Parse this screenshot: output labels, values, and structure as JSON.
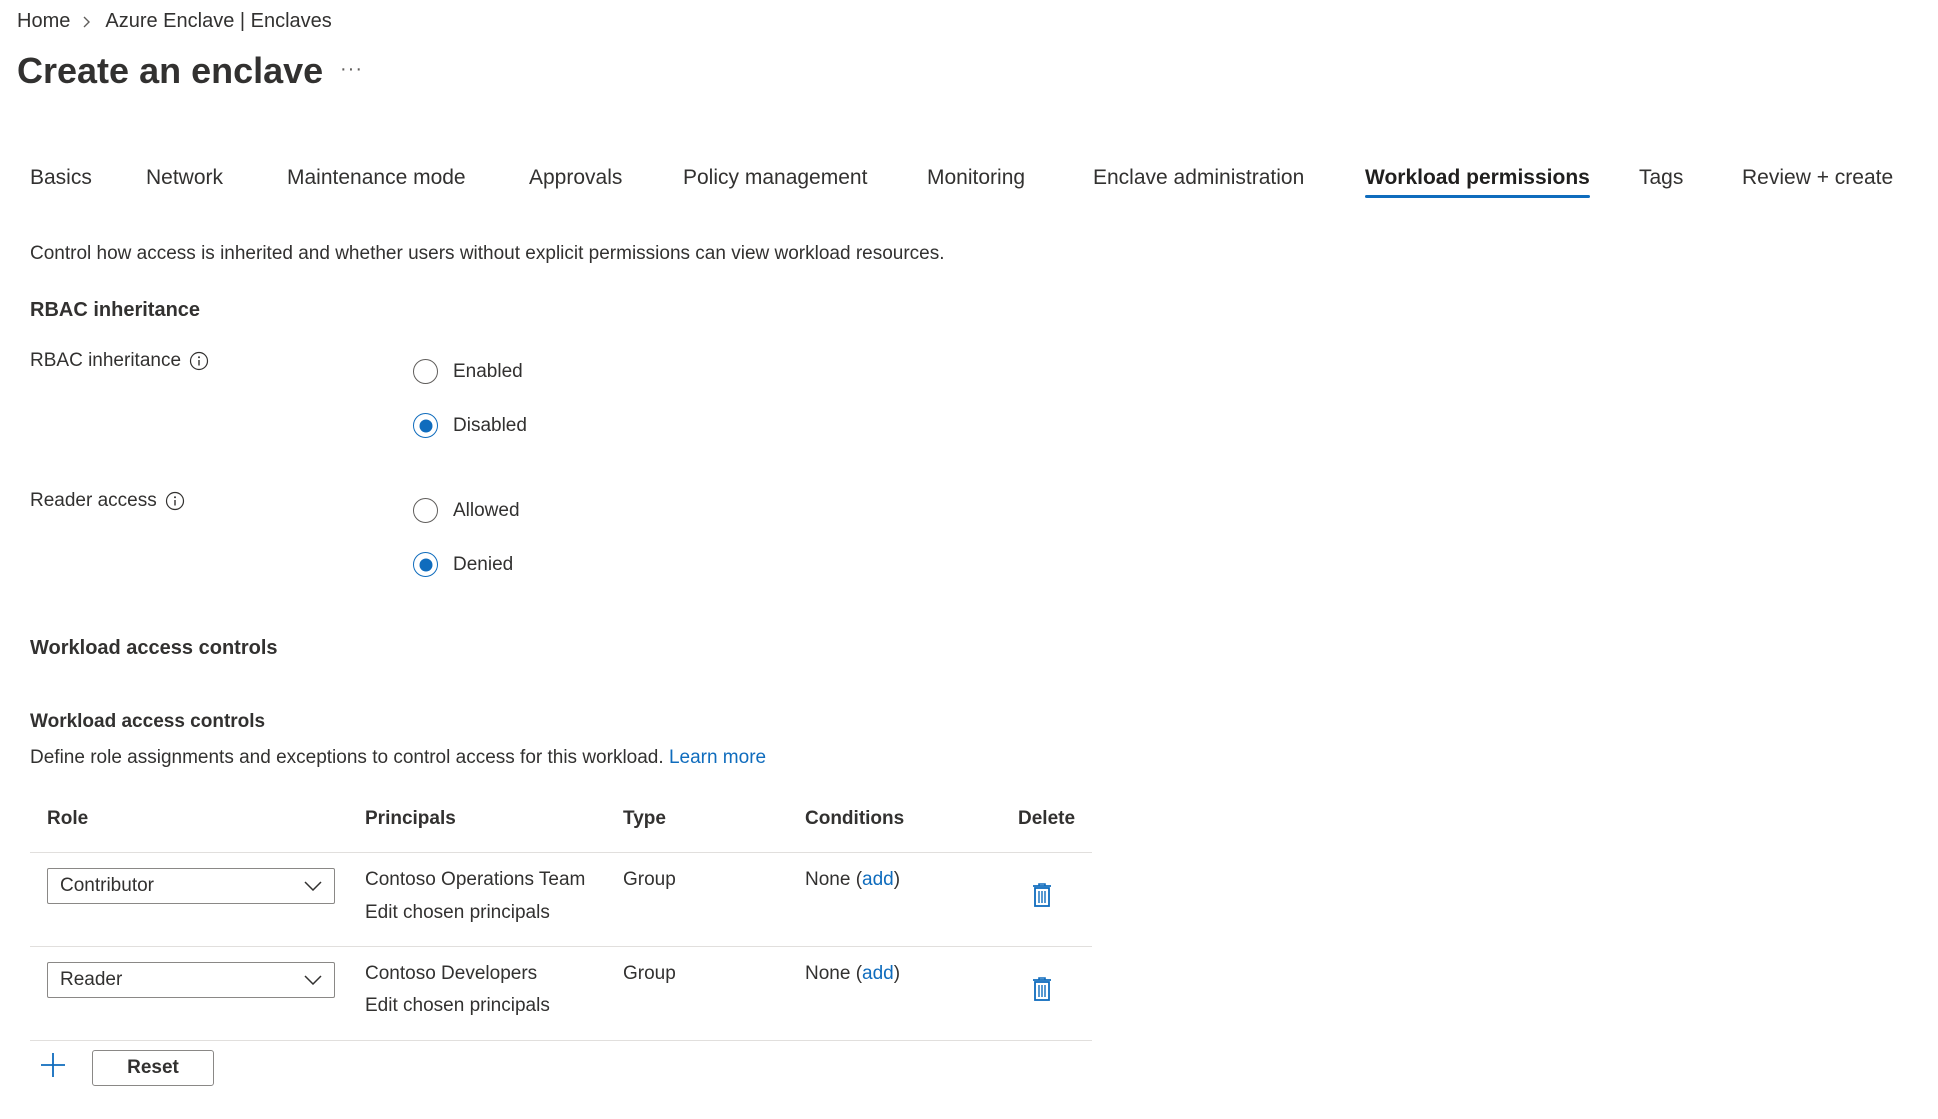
{
  "breadcrumb": {
    "home": "Home",
    "parent": "Azure Enclave | Enclaves"
  },
  "page": {
    "title": "Create an enclave",
    "more": "···"
  },
  "tabs": [
    {
      "label": "Basics",
      "active": false
    },
    {
      "label": "Network",
      "active": false
    },
    {
      "label": "Maintenance mode",
      "active": false
    },
    {
      "label": "Approvals",
      "active": false
    },
    {
      "label": "Policy management",
      "active": false
    },
    {
      "label": "Monitoring",
      "active": false
    },
    {
      "label": "Enclave administration",
      "active": false
    },
    {
      "label": "Workload permissions",
      "active": true
    },
    {
      "label": "Tags",
      "active": false
    },
    {
      "label": "Review + create",
      "active": false
    }
  ],
  "description": "Control how access is inherited and whether users without explicit permissions can view workload resources.",
  "rbac_section": {
    "title": "RBAC inheritance",
    "field_label": "RBAC inheritance",
    "options": [
      {
        "label": "Enabled",
        "checked": false
      },
      {
        "label": "Disabled",
        "checked": true
      }
    ]
  },
  "reader_access": {
    "field_label": "Reader access",
    "options": [
      {
        "label": "Allowed",
        "checked": false
      },
      {
        "label": "Denied",
        "checked": true
      }
    ]
  },
  "workload_section": {
    "title": "Workload access controls",
    "subtitle": "Workload access controls",
    "help_text": "Define role assignments and exceptions to control access for this workload.",
    "learn_more": "Learn more"
  },
  "table": {
    "headers": {
      "role": "Role",
      "principals": "Principals",
      "type": "Type",
      "conditions": "Conditions",
      "delete": "Delete"
    },
    "rows": [
      {
        "role": "Contributor",
        "principal": "Contoso Operations Team",
        "edit_link": "Edit chosen principals",
        "type": "Group",
        "conditions_prefix": "None (",
        "conditions_link": "add",
        "conditions_suffix": ")"
      },
      {
        "role": "Reader",
        "principal": "Contoso Developers",
        "edit_link": "Edit chosen principals",
        "type": "Group",
        "conditions_prefix": "None (",
        "conditions_link": "add",
        "conditions_suffix": ")"
      }
    ]
  },
  "actions": {
    "reset_label": "Reset"
  },
  "colors": {
    "accent": "#0f6cbd",
    "text": "#323130",
    "border": "#8a8886"
  }
}
